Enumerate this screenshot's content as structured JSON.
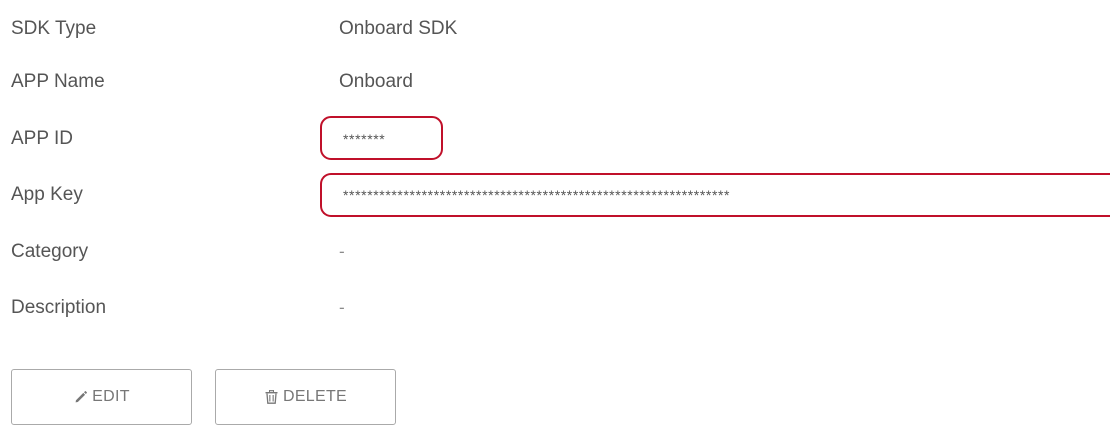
{
  "details": {
    "rows": [
      {
        "label": "SDK Type",
        "value": "Onboard SDK"
      },
      {
        "label": "APP Name",
        "value": "Onboard"
      },
      {
        "label": "APP ID",
        "value": "*******"
      },
      {
        "label": "App Key",
        "value": "****************************************************************"
      },
      {
        "label": "Category",
        "value": "-"
      },
      {
        "label": "Description",
        "value": "-"
      }
    ]
  },
  "actions": {
    "edit_label": "EDIT",
    "delete_label": "DELETE"
  },
  "icons": {
    "edit": "pencil-icon",
    "delete": "trash-icon"
  },
  "colors": {
    "highlight": "#c0102a",
    "text": "#555555",
    "button_border": "#aaaaaa"
  }
}
